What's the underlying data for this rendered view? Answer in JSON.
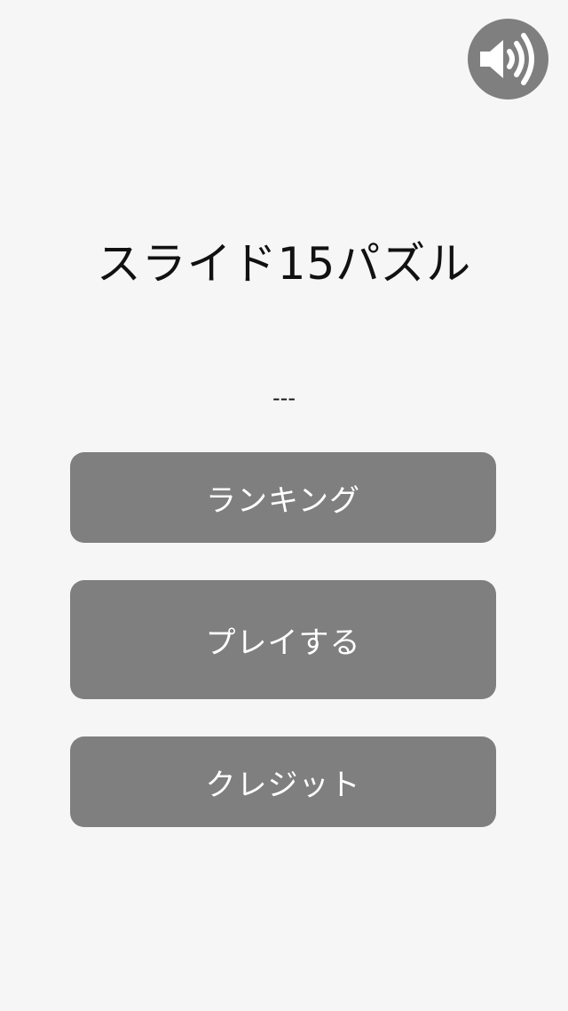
{
  "app": {
    "title": "スライド15パズル",
    "score_text": "---"
  },
  "menu": {
    "ranking_label": "ランキング",
    "play_label": "プレイする",
    "credit_label": "クレジット"
  },
  "sound": {
    "icon": "speaker-volume-icon",
    "state": "on"
  },
  "colors": {
    "background": "#f6f6f6",
    "button": "#7f7f7f",
    "button_text": "#ffffff",
    "title_text": "#111111"
  }
}
